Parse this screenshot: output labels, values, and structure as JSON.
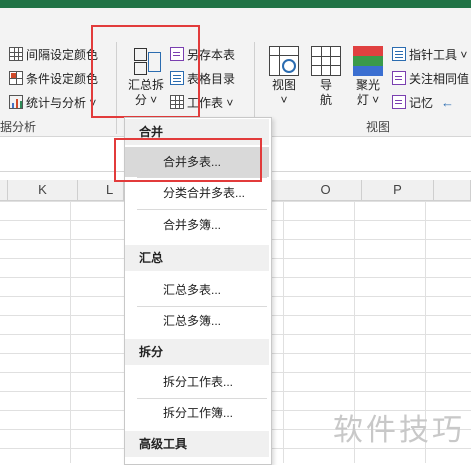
{
  "ribbon": {
    "left_col": [
      {
        "icon": "grid-icon",
        "label": "间隔设定颜色"
      },
      {
        "icon": "grid-accent-icon",
        "label": "条件设定颜色"
      },
      {
        "icon": "chart-icon",
        "label": "统计与分析 ˅"
      }
    ],
    "group_left_label": "据分析",
    "consolidate_button": {
      "line1": "汇总拆",
      "line2": "分 ˅"
    },
    "mid_col": [
      {
        "icon": "save-copy-icon",
        "label": "另存本表"
      },
      {
        "icon": "table-directory-icon",
        "label": "表格目录"
      },
      {
        "icon": "worksheet-icon",
        "label": "工作表 ˅"
      }
    ],
    "view_buttons": [
      {
        "label": "视图",
        "sub": "˅"
      },
      {
        "label": "导",
        "sub": "航"
      },
      {
        "label": "聚光",
        "sub": "灯 ˅"
      }
    ],
    "right_col": [
      {
        "label": "指针工具 ˅"
      },
      {
        "label": "关注相同值"
      },
      {
        "label": "记忆"
      }
    ],
    "back_arrow": "←",
    "group_view_label": "视图"
  },
  "columns": [
    "K",
    "L",
    "O",
    "P"
  ],
  "menu": {
    "sections": [
      {
        "title": "合并",
        "items": [
          "合并多表...",
          "分类合并多表...",
          "合并多簿..."
        ]
      },
      {
        "title": "汇总",
        "items": [
          "汇总多表...",
          "汇总多簿..."
        ]
      },
      {
        "title": "拆分",
        "items": [
          "拆分工作表...",
          "拆分工作簿..."
        ]
      },
      {
        "title": "高级工具",
        "items": []
      }
    ],
    "selected_item": "合并多表..."
  },
  "colors": {
    "accent_green": "#217346",
    "highlight_red": "#e23b3b",
    "selected_bg": "#d9d9d9"
  },
  "watermark": "软件技巧"
}
